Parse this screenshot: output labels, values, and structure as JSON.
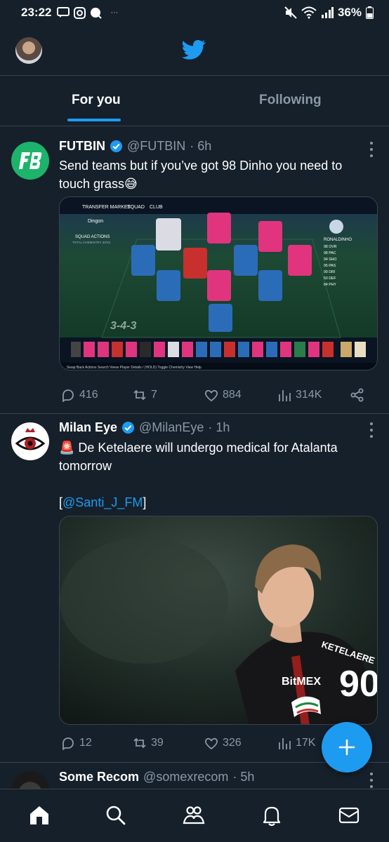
{
  "status_bar": {
    "time": "23:22",
    "battery": "36%",
    "overflow": "···"
  },
  "tabs": [
    {
      "label": "For you",
      "active": true
    },
    {
      "label": "Following",
      "active": false
    }
  ],
  "tweets": [
    {
      "name": "FUTBIN",
      "handle": "@FUTBIN",
      "time": "· 6h",
      "text": "Send teams but if you’ve got 98 Dinho you need to touch grass😅",
      "media": {
        "top_tabs": [
          "TRANSFER MARKET",
          "SQUAD",
          "CLUB"
        ],
        "squad_name": "Dingon",
        "squad_actions": "SQUAD ACTIONS",
        "total_chemistry": "TOTAL CHEMISTRY 30/33",
        "formation": "3-4-3",
        "player_name": "RONALDINHO",
        "stats": [
          "98 OVR",
          "98 PAC",
          "94 SHO",
          "95 PAS",
          "99 DRI",
          "50 DEF",
          "84 PHY"
        ],
        "bottom_bar": "Swap  Back  Actions  Search  Views  Player Details / (HOLD) Toggle Chemistry View  Help"
      },
      "replies": "416",
      "retweets": "7",
      "likes": "884",
      "views": "314K"
    },
    {
      "name": "Milan Eye",
      "handle": "@MilanEye",
      "time": "· 1h",
      "text": "🚨 De Ketelaere will undergo medical for Atalanta tomorrow",
      "mention_open": "[",
      "mention": "@Santi_J_FM",
      "mention_close": "]",
      "media": {
        "jersey_sponsor": "BitMEX",
        "jersey_name": "KETELAERE",
        "jersey_number": "90"
      },
      "replies": "12",
      "retweets": "39",
      "likes": "326",
      "views": "17K"
    },
    {
      "name": "Some Recom",
      "handle": "@somexrecom",
      "time": "· 5h"
    }
  ],
  "fab": {
    "icon": "plus-icon"
  },
  "bottom_nav": [
    "home-icon",
    "search-icon",
    "communities-icon",
    "notifications-icon",
    "messages-icon"
  ],
  "colors": {
    "background": "#15202b",
    "accent": "#1d9bf0",
    "muted": "#8b98a5",
    "divider": "#38444d"
  }
}
